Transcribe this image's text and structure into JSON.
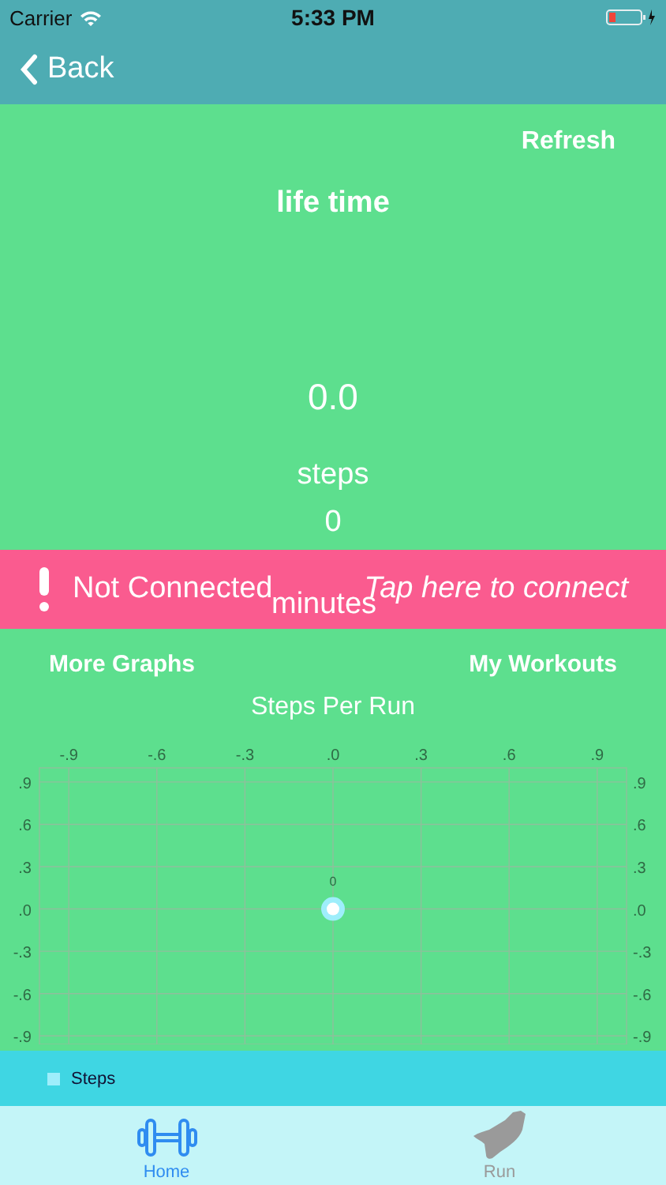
{
  "status_bar": {
    "carrier": "Carrier",
    "time": "5:33 PM"
  },
  "nav": {
    "back": "Back"
  },
  "header": {
    "refresh": "Refresh",
    "title": "life time",
    "distance": "0.0",
    "steps_label": "steps",
    "minutes_value": "0",
    "minutes_label": "minutes"
  },
  "banner": {
    "status": "Not Connected",
    "action": "Tap here to connect"
  },
  "links": [
    "More Graphs",
    "My Workouts"
  ],
  "chart": {
    "title": "Steps Per Run",
    "chart_data": {
      "type": "scatter",
      "grid": true,
      "xlim": [
        -1,
        1
      ],
      "ylim": [
        -0.96,
        1
      ],
      "xticks": [
        {
          "value": -0.9,
          "label": "-.9"
        },
        {
          "value": -0.6,
          "label": "-.6"
        },
        {
          "value": -0.3,
          "label": "-.3"
        },
        {
          "value": 0,
          "label": ".0"
        },
        {
          "value": 0.3,
          "label": ".3"
        },
        {
          "value": 0.6,
          "label": ".6"
        },
        {
          "value": 0.9,
          "label": ".9"
        }
      ],
      "yticks": [
        {
          "value": 0.9,
          "label": ".9"
        },
        {
          "value": 0.6,
          "label": ".6"
        },
        {
          "value": 0.3,
          "label": ".3"
        },
        {
          "value": 0,
          "label": ".0"
        },
        {
          "value": -0.3,
          "label": "-.3"
        },
        {
          "value": -0.6,
          "label": "-.6"
        },
        {
          "value": -0.9,
          "label": "-.9"
        }
      ],
      "series": [
        {
          "name": "Steps",
          "color": "#9eeefb",
          "x": [
            0
          ],
          "values": [
            0
          ]
        }
      ],
      "value_labels": [
        "0"
      ]
    }
  },
  "tabs": [
    {
      "label": "Home",
      "kind": "dumbbell",
      "selected": true
    },
    {
      "label": "Run",
      "kind": "shoe",
      "selected": false
    }
  ]
}
